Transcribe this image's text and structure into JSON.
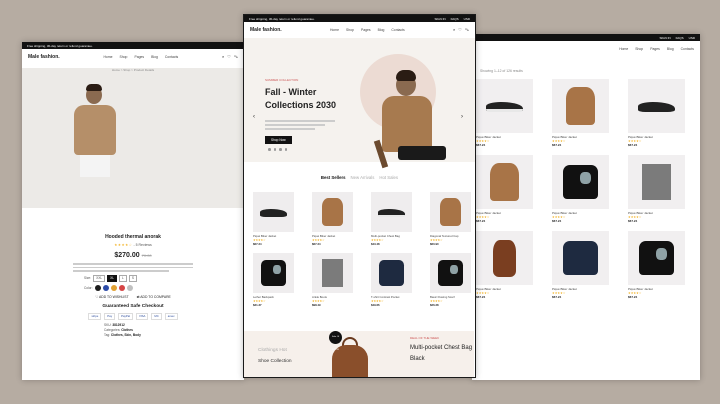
{
  "top_bar": {
    "promo": "Free shipping, 30-day return or refund guarantee.",
    "sign_in": "SIGN IN",
    "faqs": "FAQS",
    "currency": "USD"
  },
  "brand": "Male fashion.",
  "nav_items": [
    "Home",
    "Shop",
    "Pages",
    "Blog",
    "Contacts"
  ],
  "product_page": {
    "breadcrumb": "Home > Shop > Product Details",
    "name": "Hooded thermal anorak",
    "reviews": "- 5 Reviews",
    "price": "$270.00",
    "old_price": "70.00",
    "size_label": "Size:",
    "sizes": [
      "XXL",
      "XL",
      "L",
      "S"
    ],
    "selected_size": "XL",
    "color_label": "Color:",
    "colors": [
      "#1d1d1d",
      "#2c4ba8",
      "#e2a234",
      "#d64545",
      "#c0c0c0"
    ],
    "qty": "1",
    "add_to_cart": "ADD TO CART",
    "wishlist": "ADD TO WISHLIST",
    "compare": "ADD TO COMPARE",
    "checkout_title": "Guaranteed Safe Checkout",
    "payments": [
      "stripe",
      "Pay",
      "PayPal",
      "VISA",
      "MC",
      "amex"
    ],
    "sku_label": "SKU:",
    "sku": "3812912",
    "category_label": "Categories:",
    "category": "Clothes",
    "tag_label": "Tag:",
    "tags": "Clothes, Skin, Body"
  },
  "home_page": {
    "hero_sub": "SUMMER COLLECTION",
    "hero_title_1": "Fall - Winter",
    "hero_title_2": "Collections 2030",
    "shop_now": "Shop Now",
    "tabs": [
      "Best Sellers",
      "New Arrivals",
      "Hot Sales"
    ],
    "products": [
      {
        "name": "Piqué Biker Jacket",
        "price": "$67.24",
        "kind": "shoe"
      },
      {
        "name": "Piqué Biker Jacket",
        "price": "$67.24",
        "kind": "shirt"
      },
      {
        "name": "Multi-pocket Chest Bag",
        "price": "$43.48",
        "kind": "shoe-light"
      },
      {
        "name": "Diagonal Textured Cap",
        "price": "$60.90",
        "kind": "shirt"
      },
      {
        "name": "Lether Backpack",
        "price": "$31.37",
        "kind": "tee-print"
      },
      {
        "name": "Ankle Boots",
        "price": "$98.49",
        "kind": "towel"
      },
      {
        "name": "T-shirt Contrast Pocket",
        "price": "$49.66",
        "kind": "tee-navy"
      },
      {
        "name": "Basic Flowing Scarf",
        "price": "$26.28",
        "kind": "tee-print"
      }
    ],
    "promo_left_1": "Clothings Hot",
    "promo_left_2": "Shoe Collection",
    "promo_badge": "Sale Of $29.99",
    "promo_right_sub": "DEAL OF THE WEEK",
    "promo_right_title": "Multi-pocket Chest Bag Black"
  },
  "shop_page": {
    "showing": "Showing 1–12 of 126 results",
    "products": [
      {
        "name": "Piqué Biker Jacket",
        "price": "$67.24",
        "kind": "shoe-light"
      },
      {
        "name": "Piqué Biker Jacket",
        "price": "$67.24",
        "kind": "shirt"
      },
      {
        "name": "Piqué Biker Jacket",
        "price": "$67.24",
        "kind": "shoe"
      },
      {
        "name": "Piqué Biker Jacket",
        "price": "$67.24",
        "kind": "shirt"
      },
      {
        "name": "Piqué Biker Jacket",
        "price": "$67.24",
        "kind": "tee-print"
      },
      {
        "name": "Piqué Biker Jacket",
        "price": "$67.24",
        "kind": "towel"
      },
      {
        "name": "Piqué Biker Jacket",
        "price": "$67.24",
        "kind": "backpack"
      },
      {
        "name": "Piqué Biker Jacket",
        "price": "$67.24",
        "kind": "tee-navy"
      },
      {
        "name": "Piqué Biker Jacket",
        "price": "$67.24",
        "kind": "tee-print"
      }
    ]
  },
  "stars": "★★★★☆"
}
